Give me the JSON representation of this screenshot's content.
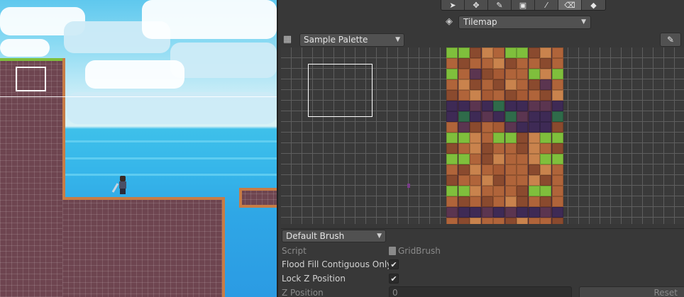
{
  "scene": {
    "colors": {
      "sky": "#8adaf3",
      "sea": "#36b6ea",
      "rock": "#6e4550",
      "rock_edge": "#c77c46",
      "grass": "#7fbf3c"
    }
  },
  "toolbar": {
    "tools": [
      {
        "name": "select",
        "icon": "select-arrow-icon",
        "glyph": "➤"
      },
      {
        "name": "move",
        "icon": "move-icon",
        "glyph": "✥"
      },
      {
        "name": "paint",
        "icon": "paintbrush-icon",
        "glyph": "✎"
      },
      {
        "name": "box-fill",
        "icon": "box-fill-icon",
        "glyph": "▣"
      },
      {
        "name": "picker",
        "icon": "eyedropper-icon",
        "glyph": "⁄"
      },
      {
        "name": "erase",
        "icon": "eraser-icon",
        "glyph": "⌫"
      },
      {
        "name": "fill",
        "icon": "paint-bucket-icon",
        "glyph": "◆"
      }
    ]
  },
  "tilemap": {
    "icon": "layers-icon",
    "glyph": "◈",
    "selected": "Tilemap",
    "caret": "▼"
  },
  "palette": {
    "icon": "palette-icon",
    "glyph": "▦",
    "selected": "Sample Palette",
    "caret": "▼",
    "edit_icon": "pencil-icon",
    "edit_glyph": "✎"
  },
  "brush": {
    "selected": "Default Brush",
    "caret": "▼"
  },
  "properties": {
    "script_label": "Script",
    "script_value": "GridBrush",
    "flood_label": "Flood Fill Contiguous Only",
    "flood_checked": "✔",
    "lockz_label": "Lock Z Position",
    "lockz_checked": "✔",
    "zpos_label": "Z Position",
    "zpos_value": "0",
    "reset_label": "Reset"
  },
  "tile_colors": [
    "#b0643a",
    "#8a4a2e",
    "#c9834d",
    "#5b3550",
    "#3e2a55",
    "#7fbf3c",
    "#2f6b4a",
    "#a65a34",
    "#4b2e3a"
  ]
}
